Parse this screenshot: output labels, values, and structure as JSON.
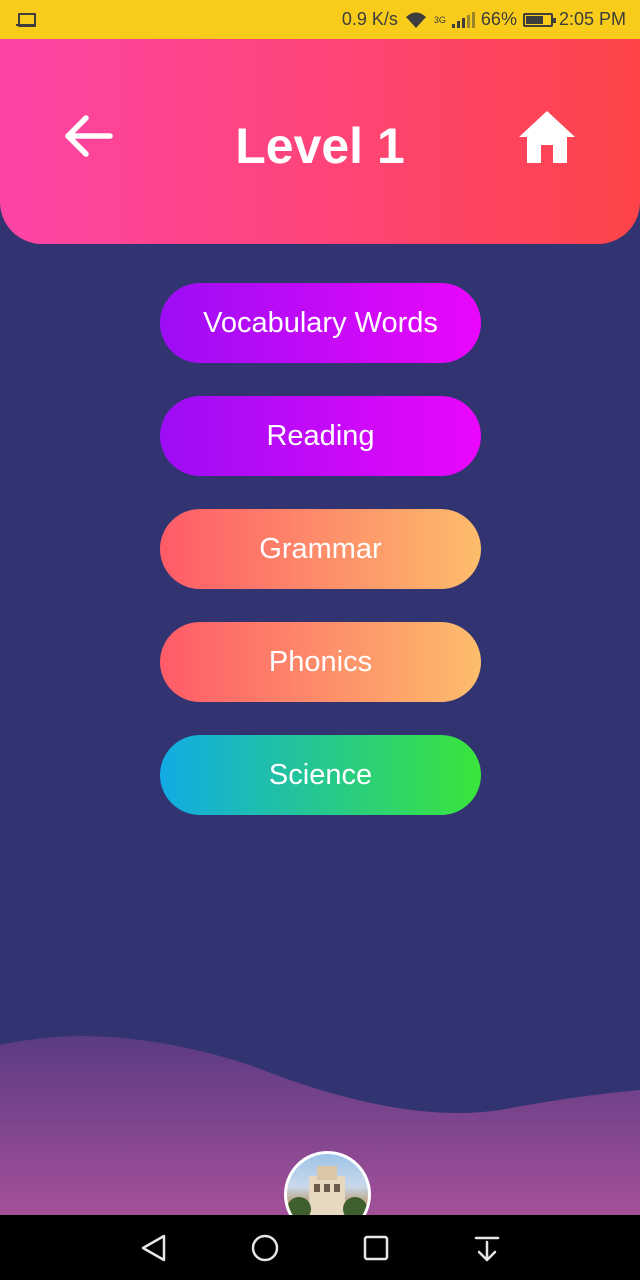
{
  "status_bar": {
    "speed": "0.9 K/s",
    "network": "3G",
    "battery": "66%",
    "time": "2:05 PM",
    "icons": [
      "laptop-icon",
      "wifi-icon",
      "signal-icon",
      "battery-icon"
    ]
  },
  "header": {
    "title": "Level 1",
    "back_icon": "arrow-left-icon",
    "home_icon": "home-icon",
    "gradient": [
      "#fd44a6",
      "#fe4448"
    ]
  },
  "menu": {
    "items": [
      {
        "label": "Vocabulary Words",
        "colors": [
          "#9d0df5",
          "#ea07fb"
        ]
      },
      {
        "label": "Reading",
        "colors": [
          "#9d0df5",
          "#ea07fb"
        ]
      },
      {
        "label": "Grammar",
        "colors": [
          "#fe5b68",
          "#fdbd6c"
        ]
      },
      {
        "label": "Phonics",
        "colors": [
          "#fe5b68",
          "#fdbd6c"
        ]
      },
      {
        "label": "Science",
        "colors": [
          "#12abe5",
          "#3ae53a"
        ]
      }
    ]
  },
  "background_color": "#313470",
  "nav_bar": {
    "icons": [
      "back-triangle-icon",
      "home-circle-icon",
      "recents-square-icon",
      "notification-pull-icon"
    ]
  }
}
